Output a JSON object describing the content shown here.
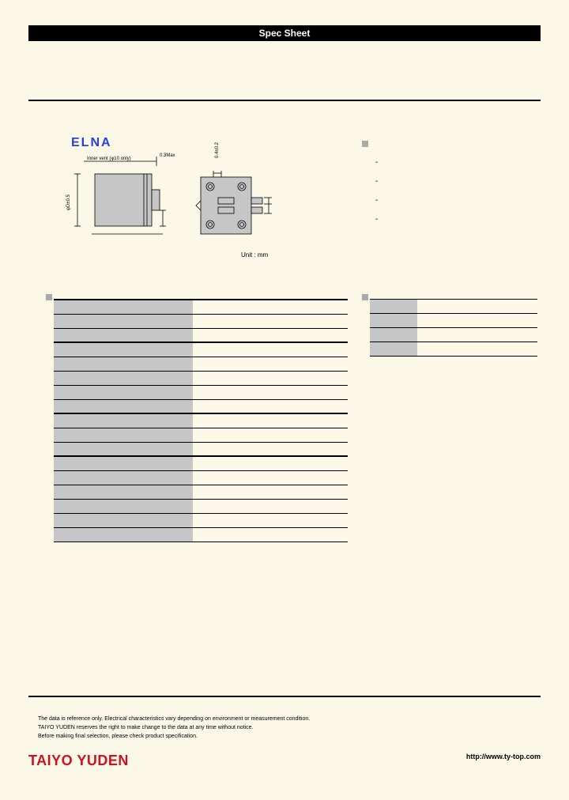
{
  "header": {
    "title": "Spec Sheet"
  },
  "logo": {
    "elna": "ELNA",
    "taiyo": "TAIYO YUDEN"
  },
  "drawing": {
    "vent_label": "Inner vent (φ10 only)",
    "gap_label": "0.3Max",
    "dim_right": "0.4±0.2",
    "dim_dia": "φD±0.5",
    "unit": "Unit : mm"
  },
  "notes": {
    "dash1": "-",
    "dash2": "-",
    "dash3": "-",
    "dash4": "-"
  },
  "spec_rows": [
    {
      "label": "",
      "value": "",
      "thick": true
    },
    {
      "label": "",
      "value": ""
    },
    {
      "label": "",
      "value": ""
    },
    {
      "label": "",
      "value": "",
      "thick": true
    },
    {
      "label": "",
      "value": ""
    },
    {
      "label": "",
      "value": ""
    },
    {
      "label": "",
      "value": ""
    },
    {
      "label": "",
      "value": ""
    },
    {
      "label": "",
      "value": "",
      "thick": true
    },
    {
      "label": "",
      "value": ""
    },
    {
      "label": "",
      "value": ""
    },
    {
      "label": "",
      "value": "",
      "thick": true
    },
    {
      "label": "",
      "value": ""
    },
    {
      "label": "",
      "value": ""
    },
    {
      "label": "",
      "value": ""
    },
    {
      "label": "",
      "value": ""
    },
    {
      "label": "",
      "value": ""
    }
  ],
  "dim_rows": [
    {
      "label": "",
      "value": ""
    },
    {
      "label": "",
      "value": ""
    },
    {
      "label": "",
      "value": ""
    },
    {
      "label": "",
      "value": ""
    }
  ],
  "disclaimer": {
    "line1": "The data is reference only. Electrical characteristics vary depending on environment or measurement condition.",
    "line2": "TAIYO YUDEN reserves the right to make change to the data at any time without notice.",
    "line3": "Before making final selection, please check product specification."
  },
  "url": "http://www.ty-top.com"
}
